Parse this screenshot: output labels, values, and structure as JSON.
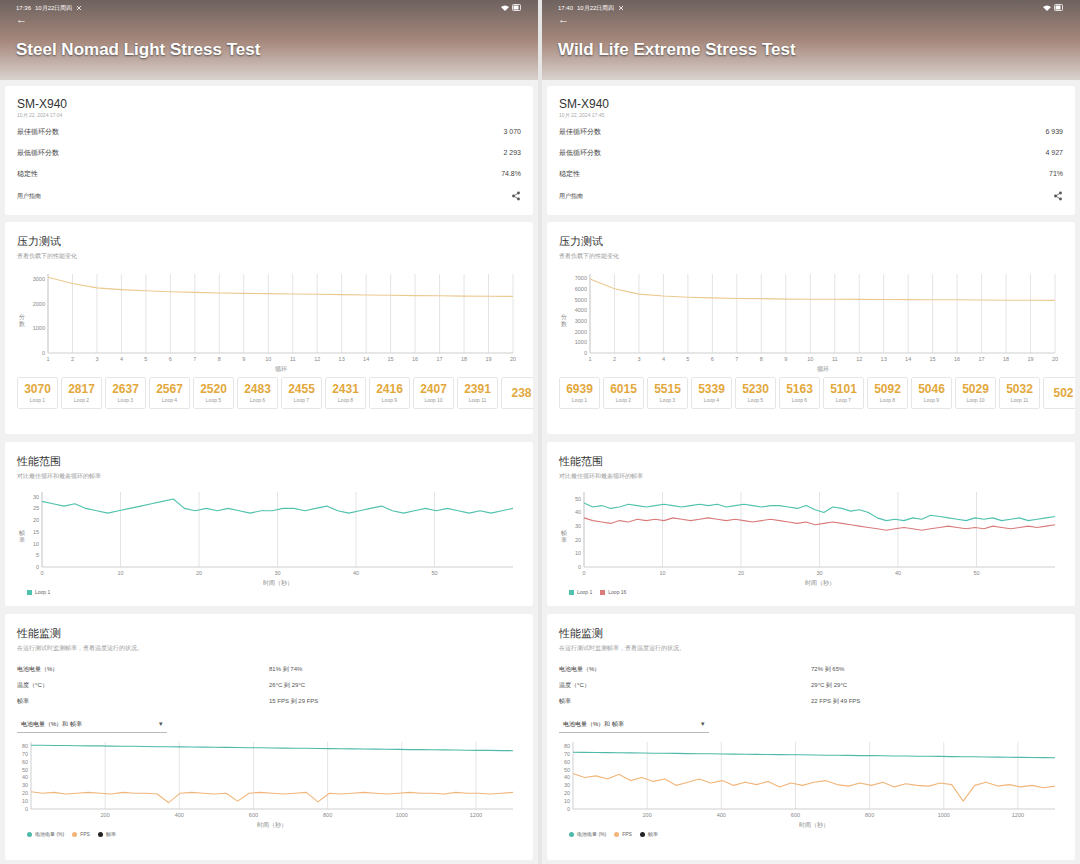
{
  "panels": [
    {
      "status": {
        "time": "17:36",
        "date": "10月22日周四"
      },
      "back": "←",
      "title": "Steel Nomad Light Stress Test",
      "device": "SM-X940",
      "timestamp": "10月 22, 2024 17:04",
      "stats": [
        {
          "label": "最佳循环分数",
          "value": "3 070"
        },
        {
          "label": "最低循环分数",
          "value": "2 293"
        },
        {
          "label": "稳定性",
          "value": "74.8%"
        }
      ],
      "guide": "用户指南",
      "stress": {
        "title": "压力测试",
        "subtitle": "查看负载下的性能变化",
        "y_label": "分数",
        "y_ticks": [
          "3000",
          "2000",
          "1000",
          "0"
        ],
        "y_range": [
          0,
          3200
        ],
        "x_ticks": [
          "1",
          "2",
          "3",
          "4",
          "5",
          "6",
          "7",
          "8",
          "9",
          "10",
          "11",
          "12",
          "13",
          "14",
          "15",
          "16",
          "17",
          "18",
          "19",
          "20"
        ],
        "x_label": "循环",
        "series": [
          {
            "color": "#ebc98f",
            "values": [
              3070,
              2817,
              2637,
              2567,
              2520,
              2483,
              2455,
              2431,
              2416,
              2407,
              2391,
              2380,
              2365,
              2350,
              2338,
              2325,
              2315,
              2305,
              2298,
              2293
            ]
          }
        ],
        "loops": [
          {
            "score": "3070",
            "label": "Loop 1"
          },
          {
            "score": "2817",
            "label": "Loop 2"
          },
          {
            "score": "2637",
            "label": "Loop 3"
          },
          {
            "score": "2567",
            "label": "Loop 4"
          },
          {
            "score": "2520",
            "label": "Loop 5"
          },
          {
            "score": "2483",
            "label": "Loop 6"
          },
          {
            "score": "2455",
            "label": "Loop 7"
          },
          {
            "score": "2431",
            "label": "Loop 8"
          },
          {
            "score": "2416",
            "label": "Loop 9"
          },
          {
            "score": "2407",
            "label": "Loop 10"
          },
          {
            "score": "2391",
            "label": "Loop 11"
          },
          {
            "score": "238"
          }
        ]
      },
      "range": {
        "title": "性能范围",
        "subtitle": "对比最佳循环和最差循环的帧率",
        "y_label": "帧率",
        "y_ticks": [
          "30",
          "25",
          "20",
          "15",
          "10",
          "5",
          "0"
        ],
        "y_range": [
          0,
          32
        ],
        "x_ticks": [
          "0",
          "10",
          "20",
          "30",
          "40",
          "50"
        ],
        "x_range": [
          0,
          60
        ],
        "x_label": "时间（秒）",
        "series": [
          {
            "label": "Loop 1",
            "color": "#4fc1ad",
            "values": [
              28,
              27,
              26,
              27,
              25,
              24,
              23,
              24,
              25,
              26,
              27,
              28,
              29,
              25,
              24,
              25,
              24,
              25,
              24,
              23,
              24,
              24,
              25,
              25,
              24,
              25,
              26,
              24,
              23,
              24,
              25,
              26,
              24,
              23,
              24,
              25,
              24,
              25,
              24,
              23,
              24,
              23,
              24,
              25
            ]
          }
        ]
      },
      "monitor": {
        "title": "性能监测",
        "subtitle": "在运行测试时监测帧率，查看温度运行的状况。",
        "rows": [
          {
            "label": "电池电量（%）",
            "value": "81% 到 74%"
          },
          {
            "label": "温度（°C）",
            "value": "26°C 到 29°C"
          },
          {
            "label": "帧率",
            "value": "15 FPS 到 29 FPS"
          }
        ],
        "dropdown": {
          "label": "电池电量（%）和 帧率",
          "arrow": "▾"
        },
        "chart": {
          "y_ticks": [
            "80",
            "70",
            "60",
            "50",
            "40",
            "30",
            "20",
            "10",
            "0"
          ],
          "y_range": [
            0,
            85
          ],
          "x_ticks": [
            "200",
            "400",
            "600",
            "800",
            "1000",
            "1200"
          ],
          "x_range": [
            0,
            1300
          ],
          "x_label": "时间（秒）",
          "series": [
            {
              "color": "#4fb9a9",
              "values": [
                81,
                80.8,
                80.6,
                80.5,
                80.3,
                80.1,
                80,
                79.8,
                79.6,
                79.5,
                79.3,
                79.1,
                79,
                78.8,
                78.6,
                78.5,
                78.3,
                78.1,
                78,
                77.8,
                77.6,
                77.4,
                77.3,
                77.1,
                77,
                76.8,
                76.6,
                76.4,
                76.3,
                76.1,
                76,
                75.8,
                75.6,
                75.4,
                75.3,
                75.1,
                75,
                74.8,
                74.6,
                74.4,
                74.3,
                74.1,
                74
              ]
            },
            {
              "color": "#f1b57a",
              "values": [
                22,
                20,
                21,
                19,
                20,
                21,
                20,
                19,
                21,
                20,
                20,
                19,
                8,
                20,
                21,
                20,
                19,
                20,
                10,
                20,
                21,
                20,
                19,
                20,
                21,
                9,
                20,
                19,
                20,
                21,
                20,
                19,
                20,
                21,
                20,
                20,
                19,
                21,
                20,
                20,
                19,
                20,
                21
              ]
            }
          ],
          "legend": [
            {
              "label": "电池电量 (%)",
              "color": "#4fb9a9"
            },
            {
              "label": "FPS",
              "color": "#f1b57a"
            },
            {
              "label": "帧率",
              "color": "#222222"
            }
          ]
        }
      }
    },
    {
      "status": {
        "time": "17:40",
        "date": "10月22日周四"
      },
      "back": "←",
      "title": "Wild Life Extreme Stress Test",
      "device": "SM-X940",
      "timestamp": "10月 22, 2024 17:45",
      "stats": [
        {
          "label": "最佳循环分数",
          "value": "6 939"
        },
        {
          "label": "最低循环分数",
          "value": "4 927"
        },
        {
          "label": "稳定性",
          "value": "71%"
        }
      ],
      "guide": "用户指南",
      "stress": {
        "title": "压力测试",
        "subtitle": "查看负载下的性能变化",
        "y_label": "分数",
        "y_ticks": [
          "7000",
          "6000",
          "5000",
          "4000",
          "3000",
          "2000",
          "1000",
          "0"
        ],
        "y_range": [
          0,
          7400
        ],
        "x_ticks": [
          "1",
          "2",
          "3",
          "4",
          "5",
          "6",
          "7",
          "8",
          "9",
          "10",
          "11",
          "12",
          "13",
          "14",
          "15",
          "16",
          "17",
          "18",
          "19",
          "20"
        ],
        "x_label": "循环",
        "series": [
          {
            "color": "#ebc98f",
            "values": [
              6939,
              6015,
              5515,
              5339,
              5230,
              5163,
              5101,
              5092,
              5046,
              5029,
              5032,
              5020,
              5010,
              5000,
              4990,
              4980,
              4960,
              4950,
              4940,
              4927
            ]
          }
        ],
        "loops": [
          {
            "score": "6939",
            "label": "Loop 1"
          },
          {
            "score": "6015",
            "label": "Loop 2"
          },
          {
            "score": "5515",
            "label": "Loop 3"
          },
          {
            "score": "5339",
            "label": "Loop 4"
          },
          {
            "score": "5230",
            "label": "Loop 5"
          },
          {
            "score": "5163",
            "label": "Loop 6"
          },
          {
            "score": "5101",
            "label": "Loop 7"
          },
          {
            "score": "5092",
            "label": "Loop 8"
          },
          {
            "score": "5046",
            "label": "Loop 9"
          },
          {
            "score": "5029",
            "label": "Loop 10"
          },
          {
            "score": "5032",
            "label": "Loop 11"
          },
          {
            "score": "502"
          }
        ]
      },
      "range": {
        "title": "性能范围",
        "subtitle": "对比最佳循环和最差循环的帧率",
        "y_label": "帧率",
        "y_ticks": [
          "50",
          "40",
          "30",
          "20",
          "10",
          "0"
        ],
        "y_range": [
          0,
          55
        ],
        "x_ticks": [
          "0",
          "10",
          "20",
          "30",
          "40",
          "50"
        ],
        "x_range": [
          0,
          60
        ],
        "x_label": "时间（秒）",
        "series": [
          {
            "label": "Loop 1",
            "color": "#4fc1ad",
            "values": [
              47,
              44,
              45,
              43,
              44,
              46,
              45,
              44,
              45,
              46,
              45,
              44,
              45,
              46,
              45,
              46,
              44,
              45,
              46,
              45,
              44,
              45,
              45,
              44,
              43,
              45,
              42,
              40,
              44,
              43,
              41,
              42,
              40,
              36,
              34,
              35,
              34,
              36,
              35,
              38,
              37,
              36,
              35,
              34,
              36,
              35,
              36,
              34,
              35,
              36,
              34,
              35,
              36,
              37
            ]
          },
          {
            "label": "Loop 16",
            "color": "#d97b7b",
            "values": [
              36,
              34,
              33,
              32,
              34,
              33,
              35,
              34,
              35,
              34,
              36,
              35,
              34,
              35,
              36,
              35,
              34,
              35,
              34,
              33,
              34,
              35,
              34,
              33,
              32,
              33,
              31,
              32,
              33,
              32,
              31,
              30,
              29,
              28,
              27,
              28,
              29,
              28,
              27,
              28,
              29,
              30,
              29,
              28,
              29,
              28,
              30,
              29,
              28,
              29,
              30,
              29,
              30,
              31
            ]
          }
        ]
      },
      "monitor": {
        "title": "性能监测",
        "subtitle": "在运行测试时监测帧率，查看温度运行的状况。",
        "rows": [
          {
            "label": "电池电量（%）",
            "value": "72% 到 65%"
          },
          {
            "label": "温度（°C）",
            "value": "29°C 到 29°C"
          },
          {
            "label": "帧率",
            "value": "22 FPS 到 49 FPS"
          }
        ],
        "dropdown": {
          "label": "电池电量（%）和 帧率",
          "arrow": "▾"
        },
        "chart": {
          "y_ticks": [
            "80",
            "70",
            "60",
            "50",
            "40",
            "30",
            "20",
            "10",
            "0"
          ],
          "y_range": [
            0,
            85
          ],
          "x_ticks": [
            "200",
            "400",
            "600",
            "800",
            "1000",
            "1200"
          ],
          "x_range": [
            0,
            1300
          ],
          "x_label": "时间（秒）",
          "series": [
            {
              "color": "#4fb9a9",
              "values": [
                72,
                71.8,
                71.7,
                71.5,
                71.3,
                71.2,
                71,
                70.8,
                70.7,
                70.5,
                70.3,
                70.2,
                70,
                69.8,
                69.7,
                69.5,
                69.3,
                69.2,
                69,
                68.8,
                68.7,
                68.5,
                68.3,
                68.2,
                68,
                67.8,
                67.7,
                67.5,
                67.3,
                67.2,
                67,
                66.8,
                66.7,
                66.5,
                66.3,
                66.2,
                66,
                65.8,
                65.7,
                65.5,
                65.3,
                65.2,
                65
              ]
            },
            {
              "color": "#f1b57a",
              "values": [
                45,
                40,
                42,
                38,
                44,
                36,
                40,
                35,
                38,
                30,
                34,
                38,
                33,
                36,
                30,
                34,
                31,
                35,
                28,
                33,
                30,
                34,
                36,
                31,
                29,
                33,
                30,
                34,
                28,
                32,
                30,
                29,
                33,
                31,
                10,
                30,
                34,
                29,
                31,
                28,
                30,
                27,
                29
              ]
            }
          ],
          "legend": [
            {
              "label": "电池电量 (%)",
              "color": "#4fb9a9"
            },
            {
              "label": "FPS",
              "color": "#f1b57a"
            },
            {
              "label": "帧率",
              "color": "#222222"
            }
          ]
        }
      }
    }
  ]
}
